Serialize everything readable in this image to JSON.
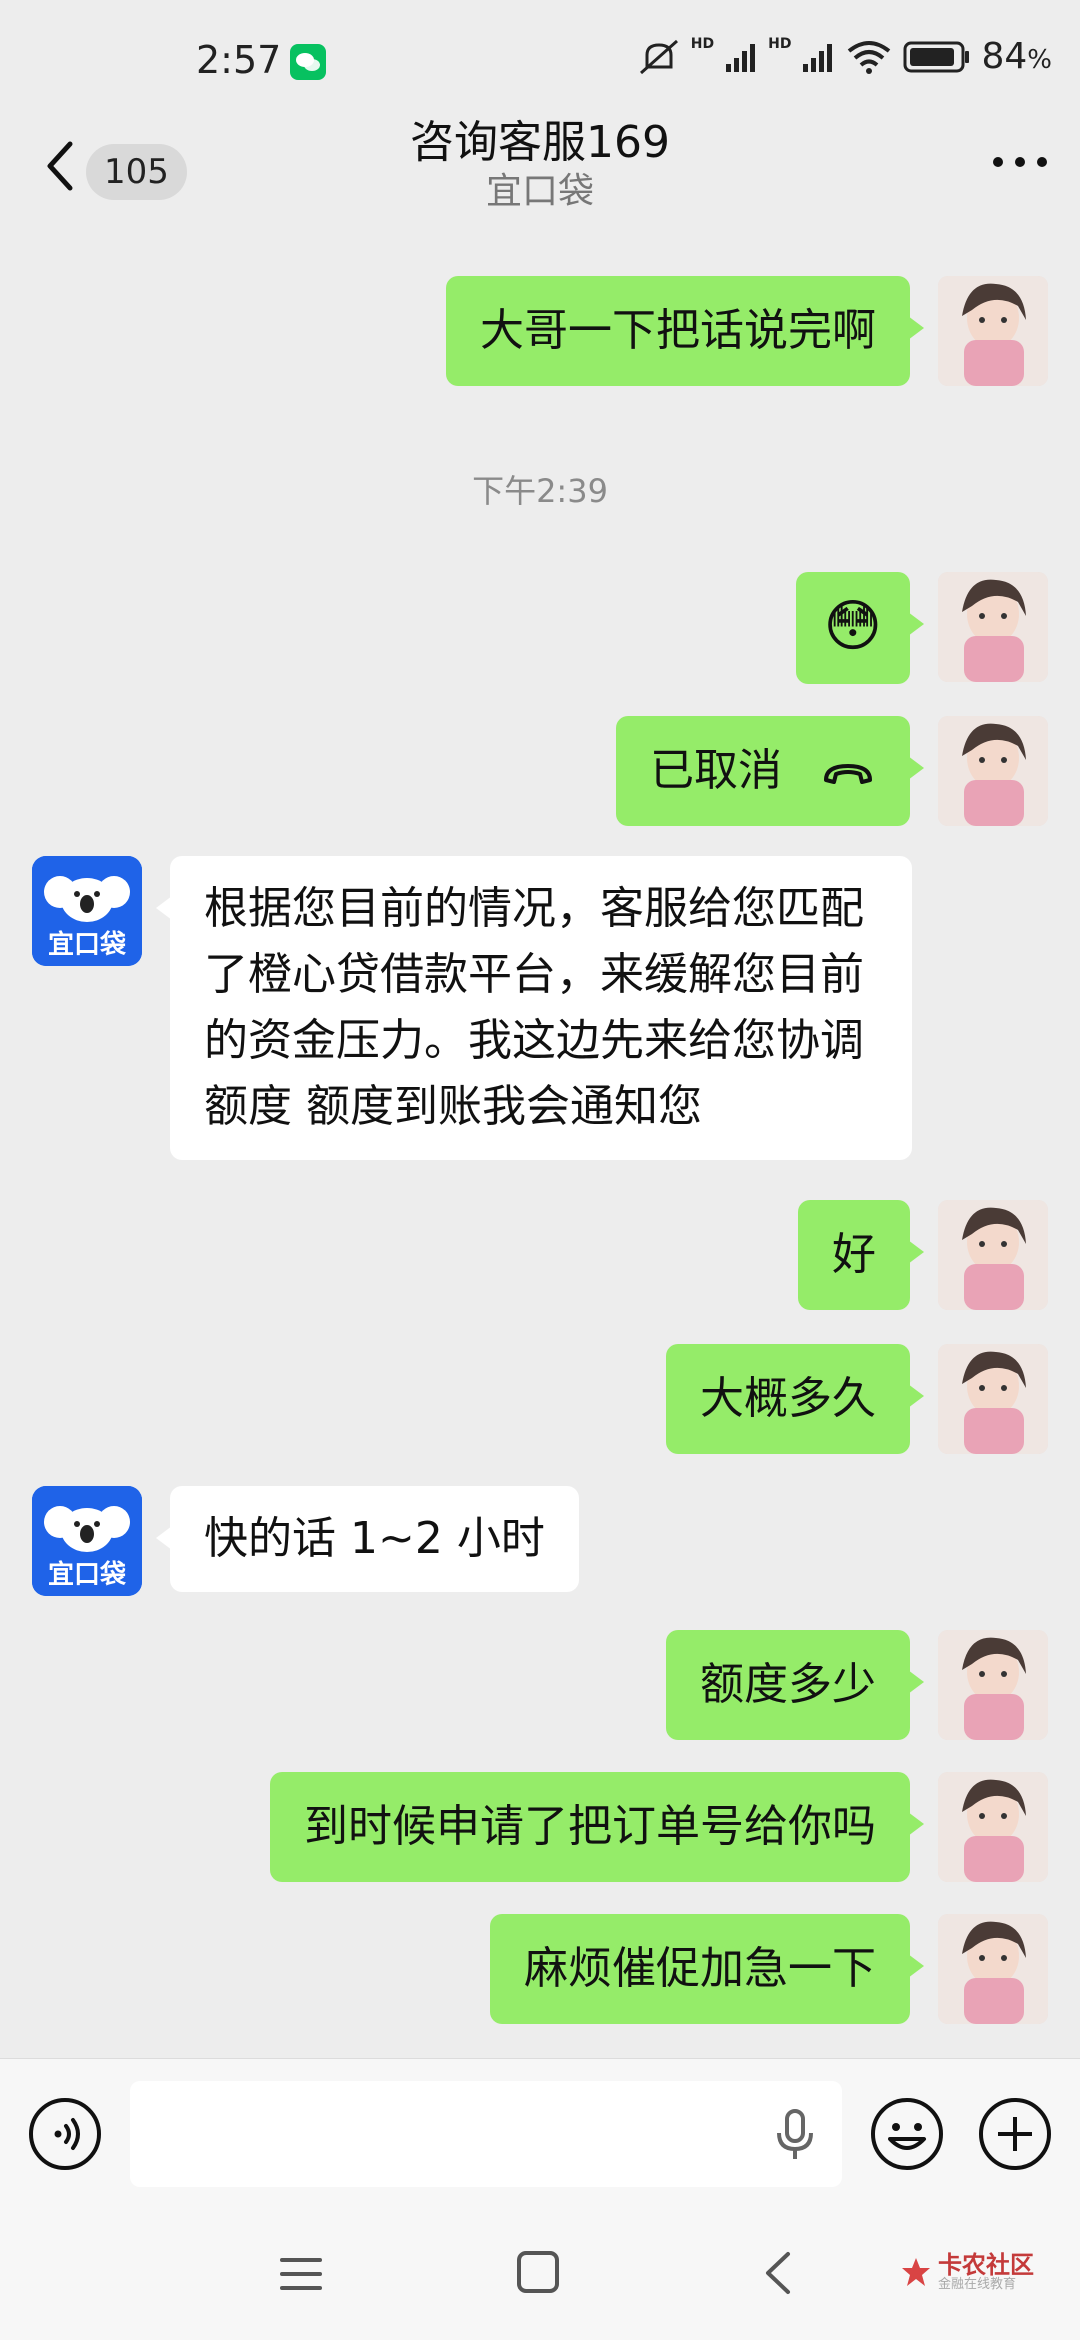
{
  "status_bar": {
    "time": "2:57",
    "battery": "84",
    "battery_unit": "%",
    "network_labels": [
      "HD",
      "HD"
    ]
  },
  "header": {
    "unread_count": "105",
    "title": "咨询客服169",
    "subtitle": "宜口袋"
  },
  "messages": {
    "m1": "大哥一下把话说完啊",
    "timestamp": "下午2:39",
    "m2_emoji": "😳",
    "m3": "已取消",
    "m4": "根据您目前的情况，客服给您匹配\n了橙心贷借款平台，来缓解您目前\n的资金压力。我这边先来给您协调\n额度 额度到账我会通知您",
    "m5": "好",
    "m6": "大概多久",
    "m7": "快的话 1~2 小时",
    "m8": "额度多少",
    "m9": "到时候申请了把订单号给你吗",
    "m10": "麻烦催促加急一下"
  },
  "bot_avatar": {
    "label": "宜口袋",
    "color": "#1f63e8"
  },
  "input": {
    "placeholder": ""
  },
  "watermark": {
    "text": "卡农社区",
    "sub": "金融在线教育"
  },
  "colors": {
    "bubble_me": "#95ec69",
    "bubble_bot": "#ffffff",
    "background": "#ededed",
    "accent": "#07c160"
  },
  "icons": {
    "back": "chevron-left-icon",
    "more": "more-dots-icon",
    "voice": "voice-icon",
    "mic": "mic-icon",
    "emoji": "emoji-icon",
    "plus": "plus-icon",
    "hangup": "hangup-icon",
    "wechat": "wechat-icon"
  }
}
